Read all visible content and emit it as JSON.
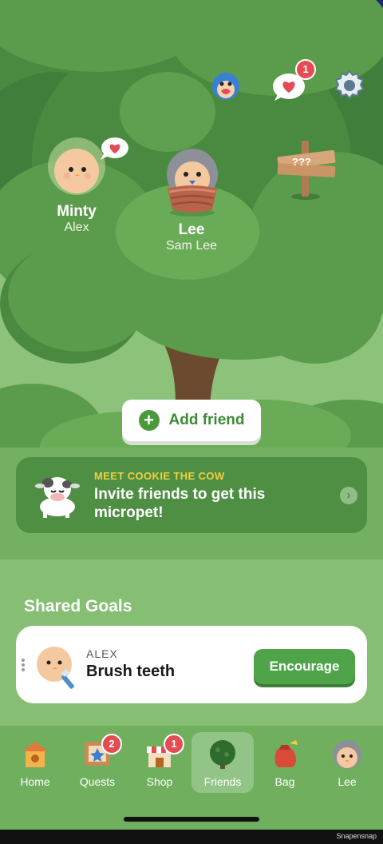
{
  "colors": {
    "sky": "#1f2a6b",
    "tree_dark": "#3f7f3b",
    "tree_mid": "#5b9b4c",
    "tree_light": "#6aab58",
    "ground": "#8cc27a",
    "accent_green": "#4fa44a",
    "promo_yellow": "#f3cf3e",
    "badge_red": "#e54b52"
  },
  "top_icons": [
    {
      "icon": "bird-with-heart-icon"
    },
    {
      "icon": "heart-speech-bubble-icon",
      "badge": "1"
    },
    {
      "icon": "gear-icon"
    }
  ],
  "friends": [
    {
      "pet_name": "Minty",
      "owner": "Alex",
      "icon": "minty-pet-icon"
    },
    {
      "pet_name": "Lee",
      "owner": "Sam Lee",
      "icon": "lee-pet-icon"
    }
  ],
  "signpost": {
    "text": "???"
  },
  "add_friend": {
    "label": "Add friend"
  },
  "promo": {
    "kicker": "MEET COOKIE THE COW",
    "message": "Invite friends to get this micropet!",
    "icon": "cow-icon"
  },
  "shared_goals": {
    "title": "Shared Goals",
    "goal": {
      "who": "ALEX",
      "task": "Brush teeth",
      "button": "Encourage"
    }
  },
  "tabs": [
    {
      "label": "Home",
      "icon": "birdhouse-icon",
      "active": false
    },
    {
      "label": "Quests",
      "icon": "quest-board-icon",
      "badge": "2",
      "active": false
    },
    {
      "label": "Shop",
      "icon": "shop-icon",
      "badge": "1",
      "active": false
    },
    {
      "label": "Friends",
      "icon": "tree-icon",
      "active": true
    },
    {
      "label": "Bag",
      "icon": "bag-icon",
      "active": false
    },
    {
      "label": "Lee",
      "icon": "lee-avatar-icon",
      "active": false
    }
  ],
  "watermark": "Snapensnap"
}
